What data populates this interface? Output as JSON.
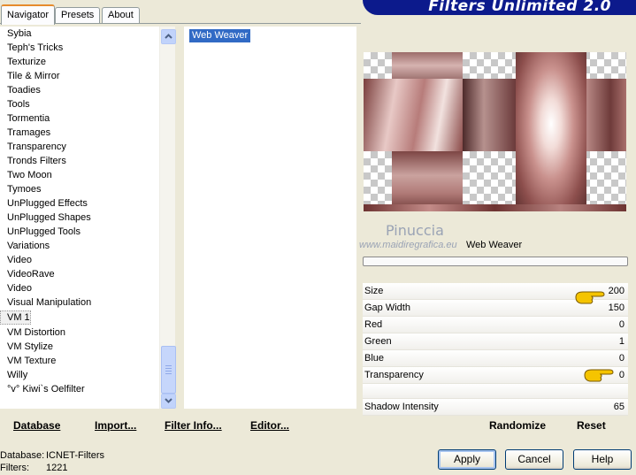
{
  "window": {
    "title": "Filters Unlimited 2.0"
  },
  "tabs": [
    {
      "label": "Navigator",
      "active": true
    },
    {
      "label": "Presets",
      "active": false
    },
    {
      "label": "About",
      "active": false
    }
  ],
  "categories": [
    "Sybia",
    "Teph's Tricks",
    "Texturize",
    "Tile & Mirror",
    "Toadies",
    "Tools",
    "Tormentia",
    "Tramages",
    "Transparency",
    "Tronds Filters",
    "Two Moon",
    "Tymoes",
    "UnPlugged Effects",
    "UnPlugged Shapes",
    "UnPlugged Tools",
    "Variations",
    "Video",
    "VideoRave",
    "Video",
    "Visual Manipulation",
    "VM 1",
    "VM Distortion",
    "VM Stylize",
    "VM Texture",
    "Willy",
    "°v° Kiwi`s Oelfilter"
  ],
  "selected_category": "VM 1",
  "filters": [
    "Web Weaver"
  ],
  "preview": {
    "watermark_name": "Pinuccia",
    "watermark_url": "www.maidiregrafica.eu",
    "filter_name": "Web Weaver"
  },
  "parameters": [
    {
      "label": "Size",
      "value": "200"
    },
    {
      "label": "Gap Width",
      "value": "150"
    },
    {
      "label": "Red",
      "value": "0"
    },
    {
      "label": "Green",
      "value": "1"
    },
    {
      "label": "Blue",
      "value": "0"
    },
    {
      "label": "Transparency",
      "value": "0"
    },
    {
      "label": "",
      "value": ""
    },
    {
      "label": "Shadow Intensity",
      "value": "65"
    }
  ],
  "bottom_buttons": {
    "database": "Database",
    "import": "Import...",
    "filter_info": "Filter Info...",
    "editor": "Editor...",
    "randomize": "Randomize",
    "reset": "Reset"
  },
  "status": {
    "database_label": "Database:",
    "database_value": "ICNET-Filters",
    "filters_label": "Filters:",
    "filters_value": "1221"
  },
  "dialog_buttons": {
    "apply": "Apply",
    "cancel": "Cancel",
    "help": "Help"
  },
  "colors": {
    "banner": "#0c1a8c",
    "selection": "#316ac5",
    "tab_accent": "#e68b2c"
  }
}
